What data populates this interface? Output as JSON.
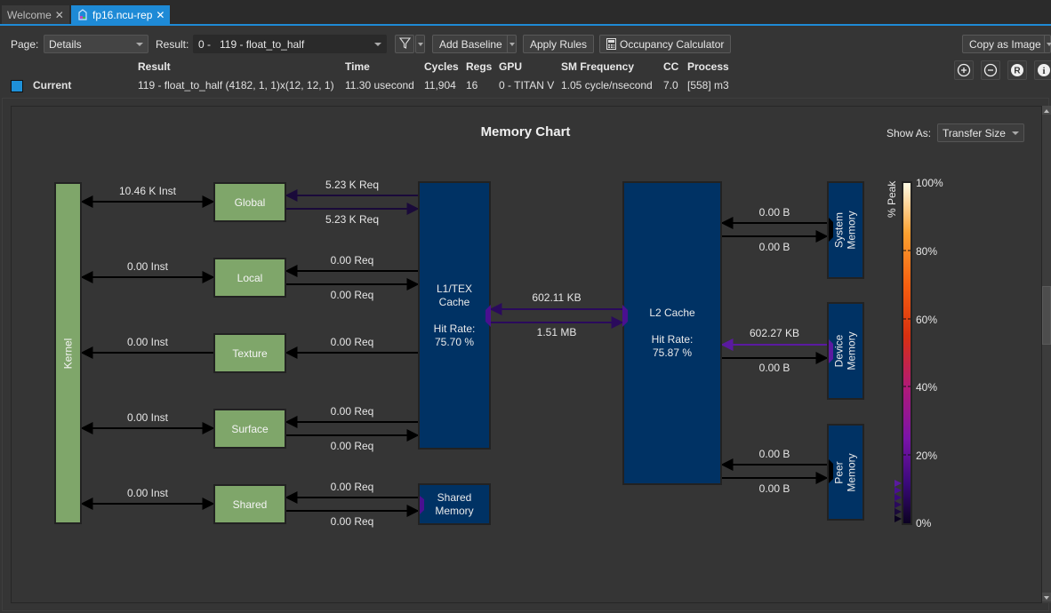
{
  "tabs": [
    {
      "label": "Welcome",
      "active": false
    },
    {
      "label": "fp16.ncu-rep",
      "active": true
    }
  ],
  "toolbar": {
    "page_label": "Page:",
    "page_value": "Details",
    "result_label": "Result:",
    "result_value": "0 -   119 - float_to_half",
    "filter_icon": "filter-icon",
    "add_baseline": "Add Baseline",
    "apply_rules": "Apply Rules",
    "occupancy_calculator": "Occupancy Calculator",
    "copy_as_image": "Copy as Image"
  },
  "result_table": {
    "headers": [
      "Result",
      "Time",
      "Cycles",
      "Regs",
      "GPU",
      "SM Frequency",
      "CC",
      "Process"
    ],
    "row": {
      "name": "Current",
      "swatch_color": "#1e90d8",
      "values": [
        "119 - float_to_half (4182, 1, 1)x(12, 12, 1)",
        "11.30 usecond",
        "11,904",
        "16",
        "0 - TITAN V",
        "1.05 cycle/nsecond",
        "7.0",
        "[558] m3"
      ]
    }
  },
  "view_icons": [
    "zoom-in-icon",
    "zoom-out-icon",
    "reset-icon",
    "info-icon"
  ],
  "chart": {
    "title": "Memory Chart",
    "show_as_label": "Show As:",
    "show_as_value": "Transfer Size",
    "kernel": "Kernel",
    "units": {
      "global": "Global",
      "local": "Local",
      "texture": "Texture",
      "surface": "Surface",
      "shared": "Shared"
    },
    "l1": {
      "name": "L1/TEX\nCache",
      "hit_label": "Hit Rate:",
      "hit_rate": "75.70 %"
    },
    "l2": {
      "name": "L2 Cache",
      "hit_label": "Hit Rate:",
      "hit_rate": "75.87 %"
    },
    "shared_memory": "Shared\nMemory",
    "system_memory": "System\nMemory",
    "device_memory": "Device\nMemory",
    "peer_memory": "Peer\nMemory",
    "kernel_links": {
      "global": "10.46 K Inst",
      "local": "0.00 Inst",
      "texture": "0.00 Inst",
      "surface": "0.00 Inst",
      "shared": "0.00 Inst"
    },
    "l1_links": {
      "global_in": "5.23 K Req",
      "global_out": "5.23 K Req",
      "local_in": "0.00 Req",
      "local_out": "0.00 Req",
      "texture_in": "0.00 Req",
      "surface_in": "0.00 Req",
      "surface_out": "0.00 Req",
      "shared_in": "0.00 Req",
      "shared_out": "0.00 Req"
    },
    "l1_l2": {
      "to_l1": "602.11 KB",
      "to_l2": "1.51 MB"
    },
    "l2_links": {
      "system_in": "0.00 B",
      "system_out": "0.00 B",
      "device_in": "602.27 KB",
      "device_out": "0.00 B",
      "peer_in": "0.00 B",
      "peer_out": "0.00 B"
    },
    "colorbar": {
      "title": "% Peak",
      "ticks": [
        "100%",
        "80%",
        "60%",
        "40%",
        "20%",
        "0%"
      ]
    },
    "colors": {
      "unit_green": "#7fa66a",
      "cache_blue": "#003264",
      "arrow_default": "#000000",
      "arrow_l1_l2": "#2a0a5c",
      "arrow_global": "#1a0a3a",
      "arrow_device": "#5a1aa0"
    }
  }
}
